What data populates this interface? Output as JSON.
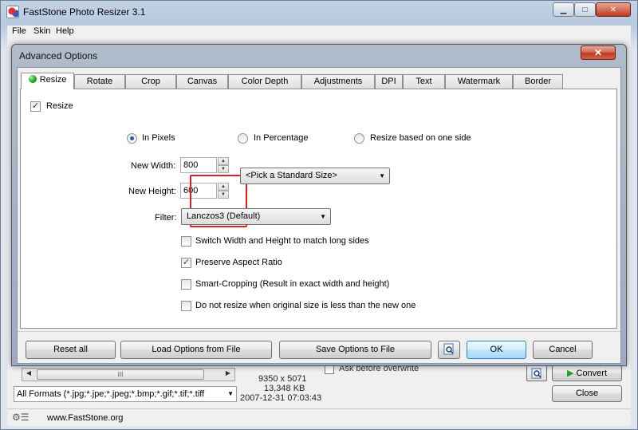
{
  "main": {
    "title": "FastStone Photo Resizer 3.1",
    "menu": [
      "File",
      "Skin",
      "Help"
    ],
    "caption_buttons": {
      "minimize": "▁",
      "maximize": "□",
      "close": "✕"
    },
    "scroll_thumb": "III",
    "format_filter": "All Formats (*.jpg;*.jpe;*.jpeg;*.bmp;*.gif;*.tif;*.tiff",
    "image_info": {
      "dimensions": "9350 x 5071",
      "size": "13,348 KB",
      "date": "2007-12-31 07:03:43"
    },
    "ask_overwrite": "Ask before overwrite",
    "convert_label": "Convert",
    "close_label": "Close",
    "status_url": "www.FastStone.org"
  },
  "dialog": {
    "title": "Advanced Options",
    "close_glyph": "✕",
    "tabs": [
      "Resize",
      "Rotate",
      "Crop",
      "Canvas",
      "Color Depth",
      "Adjustments",
      "DPI",
      "Text",
      "Watermark",
      "Border"
    ],
    "active_tab": "Resize",
    "resize": {
      "enable_label": "Resize",
      "enable_checked": true,
      "mode_options": [
        "In Pixels",
        "In Percentage",
        "Resize based on one side"
      ],
      "selected_mode": "In Pixels",
      "width_label": "New Width:",
      "width_value": "800",
      "height_label": "New Height:",
      "height_value": "600",
      "standard_size": "<Pick a Standard Size>",
      "filter_label": "Filter:",
      "filter_value": "Lanczos3 (Default)",
      "options": [
        {
          "label": "Switch Width and Height to match long sides",
          "checked": false
        },
        {
          "label": "Preserve Aspect Ratio",
          "checked": true
        },
        {
          "label": "Smart-Cropping (Result in exact width and height)",
          "checked": false
        },
        {
          "label": "Do not resize when original size is less than the new one",
          "checked": false
        }
      ]
    },
    "footer": {
      "reset_all": "Reset all",
      "load_options": "Load Options from File",
      "save_options": "Save Options to File",
      "ok": "OK",
      "cancel": "Cancel"
    }
  },
  "colors": {
    "highlight": "#e02020",
    "convert_arrow": "#1fa51f"
  }
}
